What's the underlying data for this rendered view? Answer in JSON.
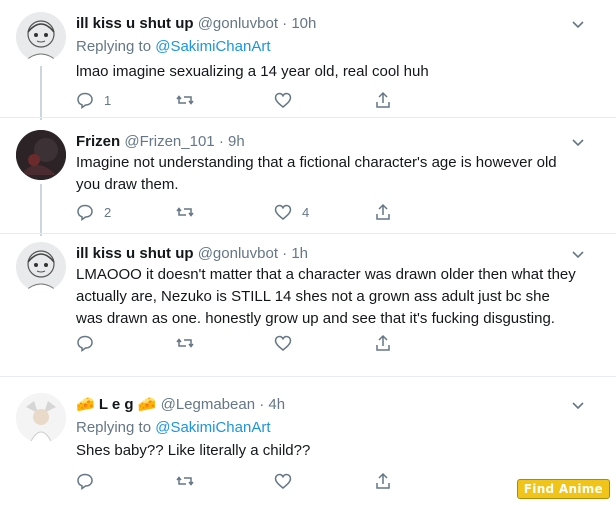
{
  "tweets": [
    {
      "name": "ill kiss u shut up",
      "handle": "@gonluvbot",
      "dot": "·",
      "time": "10h",
      "reply_prefix": "Replying to ",
      "reply_to": "@SakimiChanArt",
      "text": "lmao imagine sexualizing a 14 year old, real cool huh",
      "reply_count": "1",
      "retweet_count": "",
      "like_count": ""
    },
    {
      "name": "Frizen",
      "handle": "@Frizen_101",
      "dot": "·",
      "time": "9h",
      "text": "Imagine not understanding that a fictional character's age is however old you draw them.",
      "reply_count": "2",
      "retweet_count": "",
      "like_count": "4"
    },
    {
      "name": "ill kiss u shut up",
      "handle": "@gonluvbot",
      "dot": "·",
      "time": "1h",
      "text": "LMAOOO it doesn't matter that a character was drawn older then what they actually are, Nezuko is STILL 14 shes not a grown ass adult just bc she was drawn as one. honestly grow up and see that it's fucking disgusting.",
      "reply_count": "",
      "retweet_count": "",
      "like_count": ""
    },
    {
      "name": "🧀 L e g 🧀",
      "handle": "@Legmabean",
      "dot": "·",
      "time": "4h",
      "reply_prefix": "Replying to ",
      "reply_to": "@SakimiChanArt",
      "text": "Shes baby?? Like literally a child??",
      "reply_count": "",
      "retweet_count": "",
      "like_count": ""
    }
  ],
  "watermark": "Find Anime",
  "colors": {
    "text": "#14171a",
    "muted": "#657786",
    "link": "#1b95e0",
    "divider": "#e6ecf0",
    "thread_line": "#ccd6dd"
  }
}
